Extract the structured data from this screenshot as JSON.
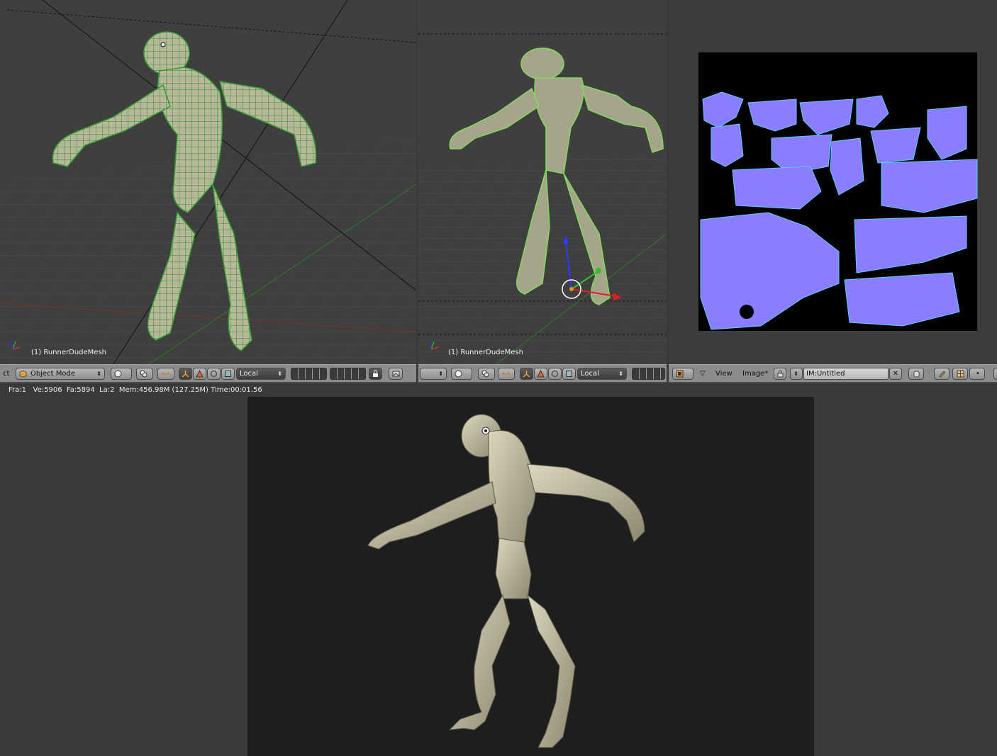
{
  "viewport_left": {
    "object_label": "(1) RunnerDudeMesh"
  },
  "viewport_middle": {
    "object_label": "(1) RunnerDudeMesh"
  },
  "header_left": {
    "cut_label": "ct",
    "mode": "Object Mode",
    "pivot": "Local"
  },
  "header_middle": {
    "pivot": "Local"
  },
  "header_image": {
    "menu_view": "View",
    "menu_image": "Image*",
    "image_name": "IM:Untitled",
    "close_glyph": "✕"
  },
  "status_bar": {
    "text": "Fra:1   Ve:5906  Fa:5894  La:2  Mem:456.98M (127.25M) Time:00:01.56"
  },
  "colors": {
    "viewport_bg": "#3f3f3f",
    "header_bg": "#8c8c8c",
    "wire": "#2f9b2f",
    "skin": "#c9c3a4",
    "normal_map": "#8080ff",
    "render_bg": "#1e1e1e"
  },
  "icons": [
    "cube-mode-icon",
    "shading-sphere-icon",
    "layers-icon",
    "transform-manipulator-icon",
    "translate-icon",
    "rotate-icon",
    "scale-icon",
    "lock-icon",
    "render-icon",
    "image-editor-icon",
    "pin-icon",
    "paint-icon",
    "uv-icon"
  ]
}
